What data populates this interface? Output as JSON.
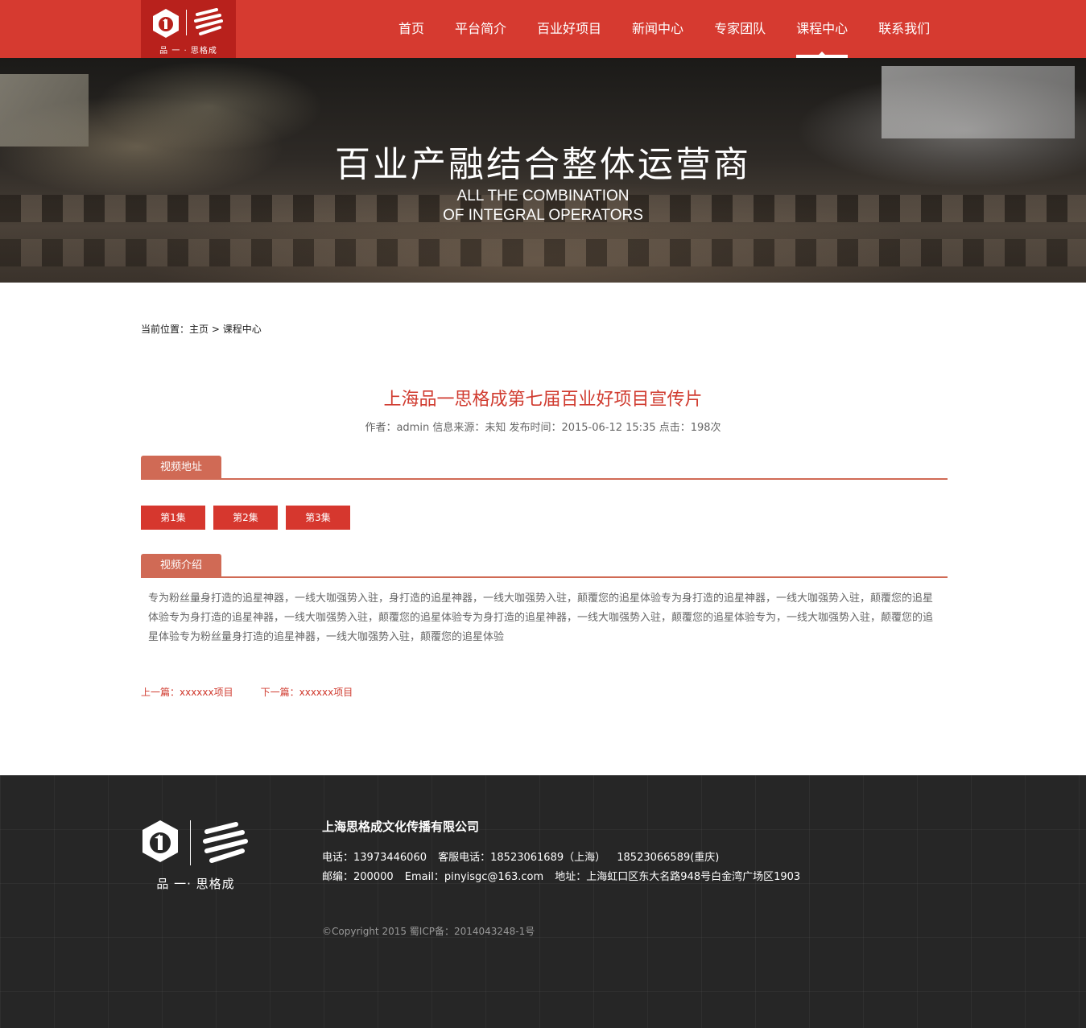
{
  "header": {
    "logo_caption": "品 一 · 思格成",
    "nav": [
      {
        "label": "首页"
      },
      {
        "label": "平台简介"
      },
      {
        "label": "百业好项目"
      },
      {
        "label": "新闻中心"
      },
      {
        "label": "专家团队"
      },
      {
        "label": "课程中心",
        "active": true
      },
      {
        "label": "联系我们"
      }
    ],
    "colors": {
      "bar": "#d63a30",
      "logo_bg": "#b8211c"
    }
  },
  "banner": {
    "title": "百业产融结合整体运营商",
    "subtitle_line1": "ALL THE COMBINATION",
    "subtitle_line2": "OF INTEGRAL OPERATORS"
  },
  "breadcrumb": {
    "prefix": "当前位置：",
    "home": "主页",
    "separator": " > ",
    "current": "课程中心"
  },
  "article": {
    "title": "上海品一思格成第七届百业好项目宣传片",
    "meta": "作者：admin 信息来源：未知 发布时间：2015-06-12 15:35 点击：198次"
  },
  "video_section": {
    "label": "视频地址",
    "episodes": [
      "第1集",
      "第2集",
      "第3集"
    ]
  },
  "intro_section": {
    "label": "视频介绍",
    "text": "专为粉丝量身打造的追星神器，一线大咖强势入驻，身打造的追星神器，一线大咖强势入驻，颠覆您的追星体验专为身打造的追星神器，一线大咖强势入驻，颠覆您的追星体验专为身打造的追星神器，一线大咖强势入驻，颠覆您的追星体验专为身打造的追星神器，一线大咖强势入驻，颠覆您的追星体验专为，一线大咖强势入驻，颠覆您的追星体验专为粉丝量身打造的追星神器，一线大咖强势入驻，颠覆您的追星体验"
  },
  "pager": {
    "prev": "上一篇：xxxxxx项目",
    "next": "下一篇：xxxxxx项目"
  },
  "footer": {
    "logo_caption": "品 一· 思格成",
    "company": "上海思格成文化传播有限公司",
    "phone": "电话：13973446060",
    "service_phone": "客服电话：18523061689（上海）",
    "service_phone2": "18523066589(重庆)",
    "postcode": "邮编：200000",
    "email": "Email：pinyisgc@163.com",
    "address": "地址：上海虹口区东大名路948号白金湾广场区1903",
    "copyright": "©Copyright 2015 蜀ICP备：2014043248-1号"
  },
  "accent_color": "#d03b2f"
}
